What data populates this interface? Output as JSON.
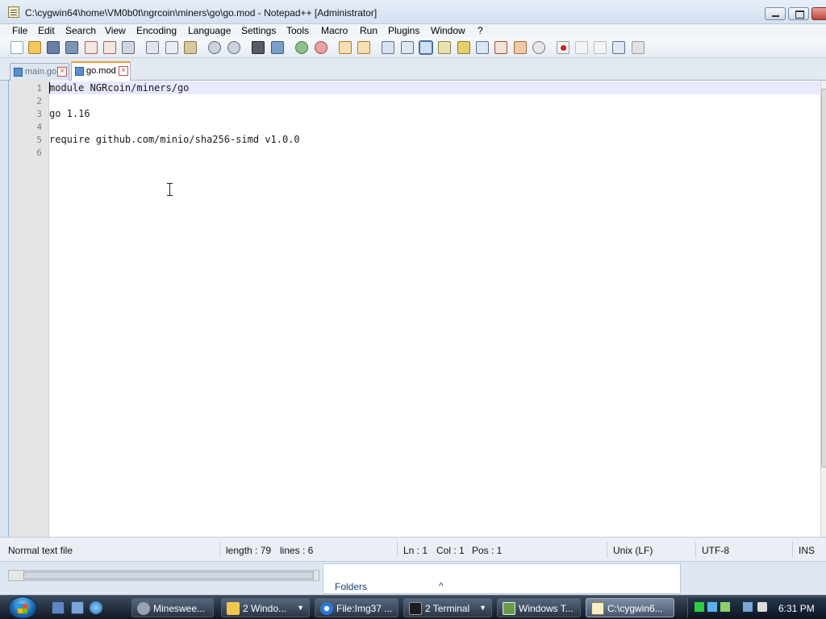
{
  "window": {
    "title": "C:\\cygwin64\\home\\VM0b0t\\ngrcoin\\miners\\go\\go.mod - Notepad++ [Administrator]"
  },
  "menu": {
    "items": [
      "File",
      "Edit",
      "Search",
      "View",
      "Encoding",
      "Language",
      "Settings",
      "Tools",
      "Macro",
      "Run",
      "Plugins",
      "Window",
      "?"
    ]
  },
  "toolbar": {
    "icons": [
      "new-file-icon",
      "open-file-icon",
      "save-icon",
      "save-all-icon",
      "close-icon",
      "close-all-icon",
      "print-icon",
      "cut-icon",
      "copy-icon",
      "paste-icon",
      "undo-icon",
      "redo-icon",
      "find-icon",
      "replace-icon",
      "zoom-in-icon",
      "zoom-out-icon",
      "sync-vertical-icon",
      "sync-horizontal-icon",
      "word-wrap-icon",
      "show-all-chars-icon",
      "indent-guide-icon",
      "lang-udl-icon",
      "xml-icon",
      "doc-map-icon",
      "function-list-icon",
      "folder-workspace-icon",
      "monitor-icon",
      "record-macro-icon",
      "stop-macro-icon",
      "play-macro-icon",
      "run-macro-multiple-icon",
      "save-macro-icon"
    ]
  },
  "tabs": [
    {
      "label": "main.go",
      "active": false
    },
    {
      "label": "go.mod",
      "active": true
    }
  ],
  "editor": {
    "line_numbers": [
      "1",
      "2",
      "3",
      "4",
      "5",
      "6"
    ],
    "lines": [
      "module NGRcoin/miners/go",
      "",
      "go 1.16",
      "",
      "require github.com/minio/sha256-simd v1.0.0",
      ""
    ]
  },
  "status": {
    "file_type": "Normal text file",
    "length": "length : 79",
    "lines": "lines : 6",
    "ln": "Ln : 1",
    "col": "Col : 1",
    "pos": "Pos : 1",
    "eol": "Unix (LF)",
    "encoding": "UTF-8",
    "mode": "INS"
  },
  "dock": {
    "folders_label": "Folders"
  },
  "taskbar": {
    "buttons": [
      {
        "label": "Minesweе...",
        "icon": "minesweeper-icon",
        "arrow": false,
        "active": false
      },
      {
        "label": "2 Windo...",
        "icon": "explorer-folder-icon",
        "arrow": true,
        "active": false
      },
      {
        "label": "File:Img37 ...",
        "icon": "browser-icon",
        "arrow": false,
        "active": false
      },
      {
        "label": "2 Terminal",
        "icon": "terminal-icon",
        "arrow": true,
        "active": false
      },
      {
        "label": "Windows T...",
        "icon": "task-manager-icon",
        "arrow": false,
        "active": false
      },
      {
        "label": "C:\\cygwin6...",
        "icon": "notepadpp-icon",
        "arrow": false,
        "active": true
      }
    ],
    "clock": "6:31 PM"
  },
  "colors": {
    "accent_tab": "#f0a030",
    "current_line": "#e8e8ff",
    "taskbar": "#1f2a38"
  }
}
